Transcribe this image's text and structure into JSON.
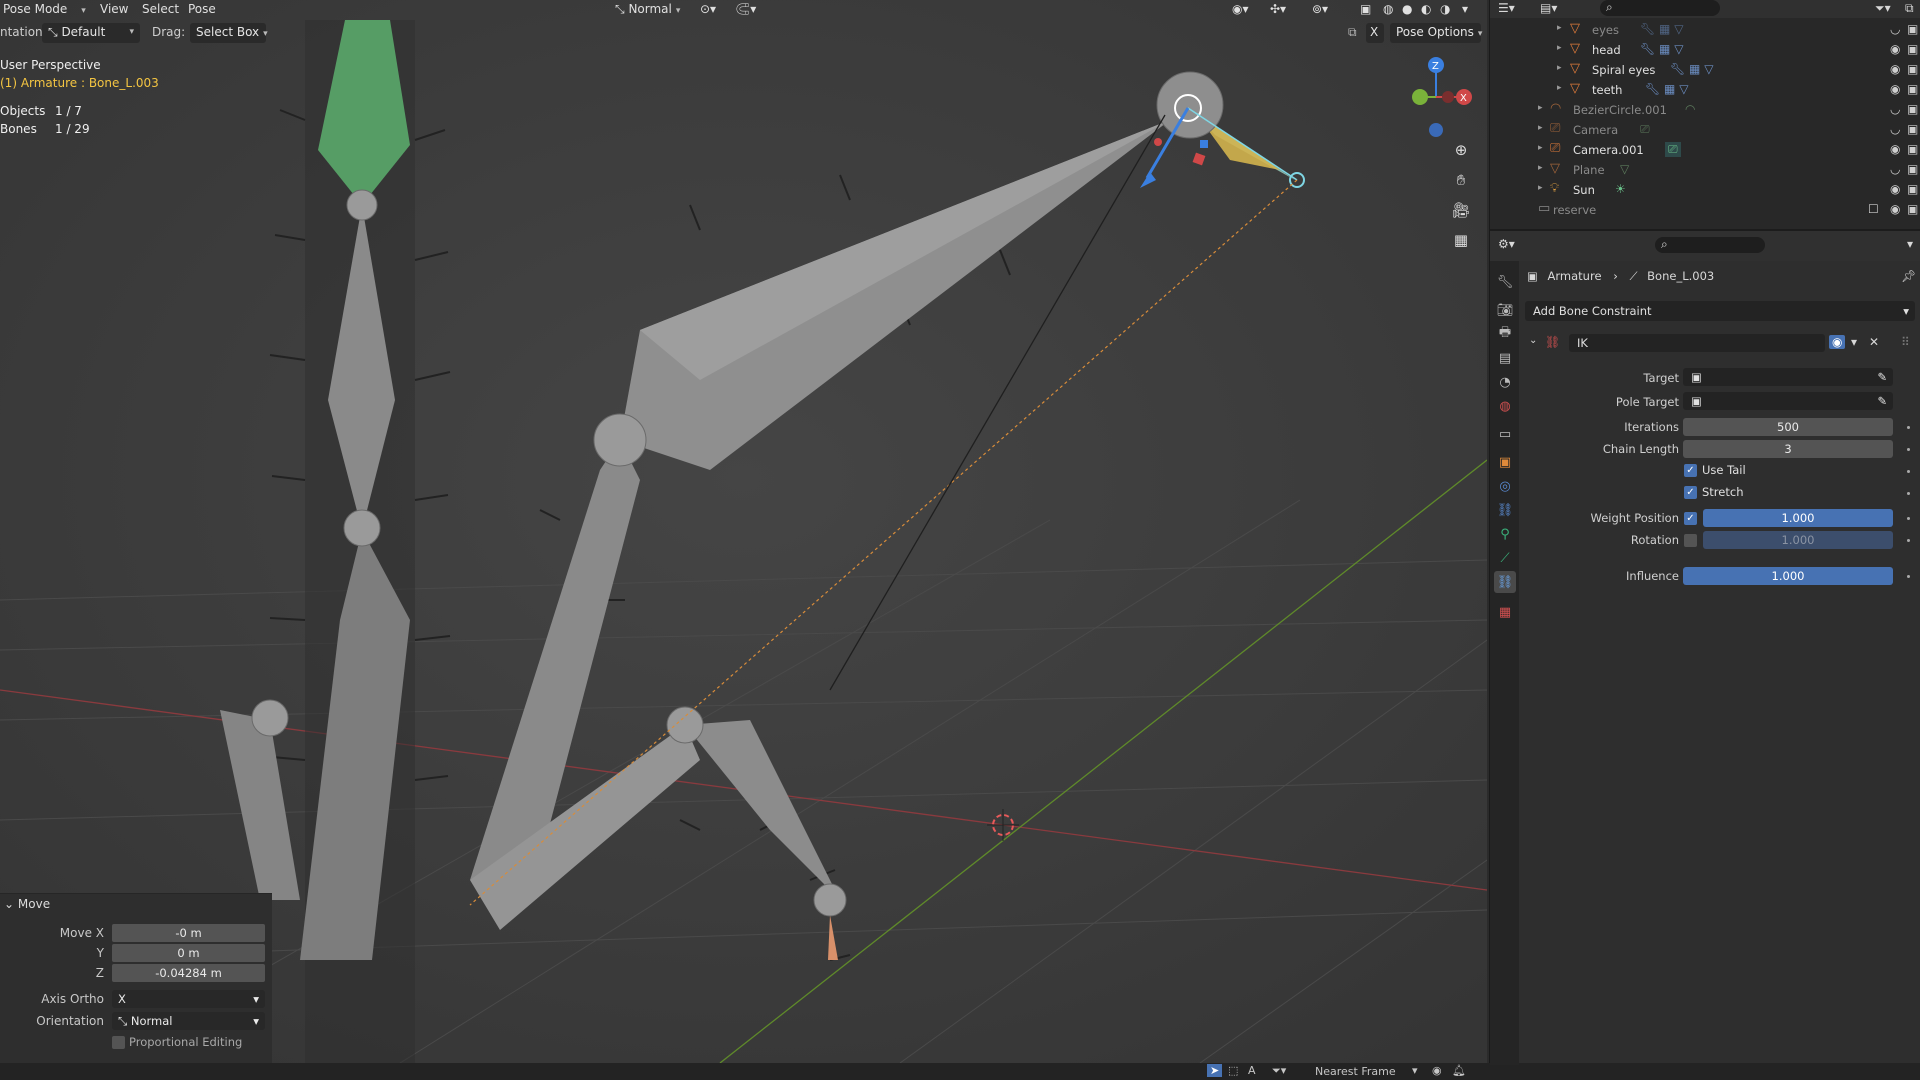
{
  "viewport_header": {
    "mode": "Pose Mode",
    "menus": [
      "View",
      "Select",
      "Pose"
    ],
    "transform_orientation": "Normal"
  },
  "tool_header": {
    "orientation_label": "ntation:",
    "orientation_value": "Default",
    "drag_label": "Drag:",
    "drag_value": "Select Box",
    "pose_options": "Pose Options",
    "x_toggle": "X"
  },
  "overlay": {
    "view_name": "User Perspective",
    "active": "(1) Armature : Bone_L.003",
    "objects_label": "Objects",
    "objects_value": "1 / 7",
    "bones_label": "Bones",
    "bones_value": "1 / 29"
  },
  "operator": {
    "title": "Move",
    "move_x_label": "Move X",
    "move_x": "-0 m",
    "y_label": "Y",
    "y": "0 m",
    "z_label": "Z",
    "z": "-0.04284 m",
    "axis_ortho_label": "Axis Ortho",
    "axis_ortho": "X",
    "orientation_label": "Orientation",
    "orientation": "Normal",
    "proportional_label": "Proportional Editing"
  },
  "statusbar": {
    "snap_target": "Nearest Frame"
  },
  "outliner": {
    "items": [
      {
        "name": "eyes",
        "icon": "mesh-icon",
        "dim": true
      },
      {
        "name": "head",
        "icon": "mesh-icon",
        "dim": false
      },
      {
        "name": "Spiral eyes",
        "icon": "mesh-icon",
        "dim": false
      },
      {
        "name": "teeth",
        "icon": "mesh-icon",
        "dim": false
      },
      {
        "name": "BezierCircle.001",
        "icon": "curve-icon",
        "dim": true
      },
      {
        "name": "Camera",
        "icon": "camera-icon",
        "dim": true
      },
      {
        "name": "Camera.001",
        "icon": "camera-icon",
        "dim": false
      },
      {
        "name": "Plane",
        "icon": "mesh-icon",
        "dim": true
      },
      {
        "name": "Sun",
        "icon": "light-icon",
        "dim": false
      },
      {
        "name": "reserve",
        "icon": "collection-icon",
        "dim": true
      }
    ]
  },
  "properties": {
    "breadcrumb_object": "Armature",
    "breadcrumb_bone": "Bone_L.003",
    "add_constraint": "Add Bone Constraint",
    "constraint_name": "IK",
    "target_label": "Target",
    "pole_target_label": "Pole Target",
    "iterations_label": "Iterations",
    "iterations": "500",
    "chain_length_label": "Chain Length",
    "chain_length": "3",
    "use_tail_label": "Use Tail",
    "stretch_label": "Stretch",
    "weight_position_label": "Weight Position",
    "weight_position": "1.000",
    "rotation_label": "Rotation",
    "rotation": "1.000",
    "influence_label": "Influence",
    "influence": "1.000"
  },
  "colors": {
    "accent_blue": "#4772b3",
    "active_bone_green": "#5fb86a",
    "x_axis": "#b8474f",
    "y_axis": "#6a9b2e",
    "overlay_yellow": "#f4c542"
  }
}
